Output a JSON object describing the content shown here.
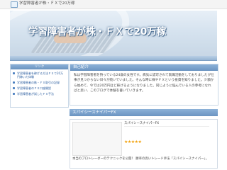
{
  "window": {
    "title": "学習障害者が株・ＦＸで20万稼"
  },
  "header": {
    "site_title": "学習障害者が株・ＦＸで20万稼"
  },
  "sidebar": {
    "heading": "リンク",
    "items": [
      {
        "label": "学習障害者を稼げる方法ＦＸで20万円稼いだ体験"
      },
      {
        "label": "学習障害者の株・ＦＸ取引の記録"
      },
      {
        "label": "学習障害者のＦＸ口座開設"
      },
      {
        "label": "学習障害者が試したＦＸ手法"
      }
    ]
  },
  "main": {
    "intro": {
      "heading": "自己紹介",
      "body": "私は学習障害者を持っている24歳の女性です。病気に認可されて就職活動をしておりましたが仕事が見つからない日々が続いていました。そんな時に株やＦＸという投資を知りました。少額から始めて、今では20万円ほど稼げるようになりました。同じように悩んでいる人の参考になればと思い、このブログで体験を書いていきます。"
    },
    "section2": {
      "heading": "スパイシースナイパーFX"
    },
    "product": {
      "name": "スパイシースナイパーFX",
      "stars": "★★★★★",
      "desc": "本当のプロトレーダーのテクニックを公開！ 勝率の高いトレード手法「スパイシースナイパー」。"
    }
  },
  "colors": {
    "accent": "#6b94c1",
    "link": "#2d5fa0",
    "star": "#f2a20c"
  }
}
